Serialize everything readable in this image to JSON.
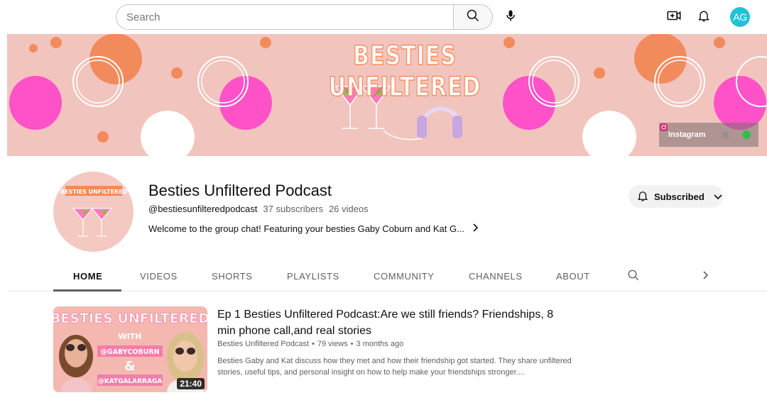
{
  "search": {
    "placeholder": "Search"
  },
  "topbar": {
    "avatar_initials": "AG"
  },
  "banner": {
    "title": "BESTIES UNFILTERED",
    "social_label": "Instagram"
  },
  "channel": {
    "name": "Besties Unfiltered Podcast",
    "handle": "@bestiesunfilteredpodcast",
    "subscribers": "37 subscribers",
    "videos": "26 videos",
    "description": "Welcome to the group chat! Featuring your besties Gaby Coburn and Kat G...",
    "avatar_text": "BESTIES UNFILTERED",
    "subscribe_label": "Subscribed"
  },
  "tabs": [
    {
      "label": "HOME",
      "active": true
    },
    {
      "label": "VIDEOS"
    },
    {
      "label": "SHORTS"
    },
    {
      "label": "PLAYLISTS"
    },
    {
      "label": "COMMUNITY"
    },
    {
      "label": "CHANNELS"
    },
    {
      "label": "ABOUT"
    }
  ],
  "video": {
    "title": "Ep 1 Besties Unfiltered Podcast:Are we still friends? Friendships, 8 min phone call,and real stories",
    "channel": "Besties Unfiltered Podcast",
    "views": "79 views",
    "age": "3 months ago",
    "description": "Besties Gaby and Kat discuss how they met and how their friendship got started. They share unfiltered stories, useful tips, and personal insight on how to help make your friendships stronger....",
    "duration": "21:40",
    "thumb_title": "BESTIES UNFILTERED",
    "thumb_with": "WITH",
    "thumb_handle1": "@GABYCOBURN",
    "thumb_amp": "&",
    "thumb_handle2": "@KATGALARRAGA"
  },
  "colors": {
    "accent_avatar": "#1fc3d6",
    "banner_bg": "#f2c4be",
    "pink": "#ff52c9",
    "orange": "#f28b5c"
  }
}
